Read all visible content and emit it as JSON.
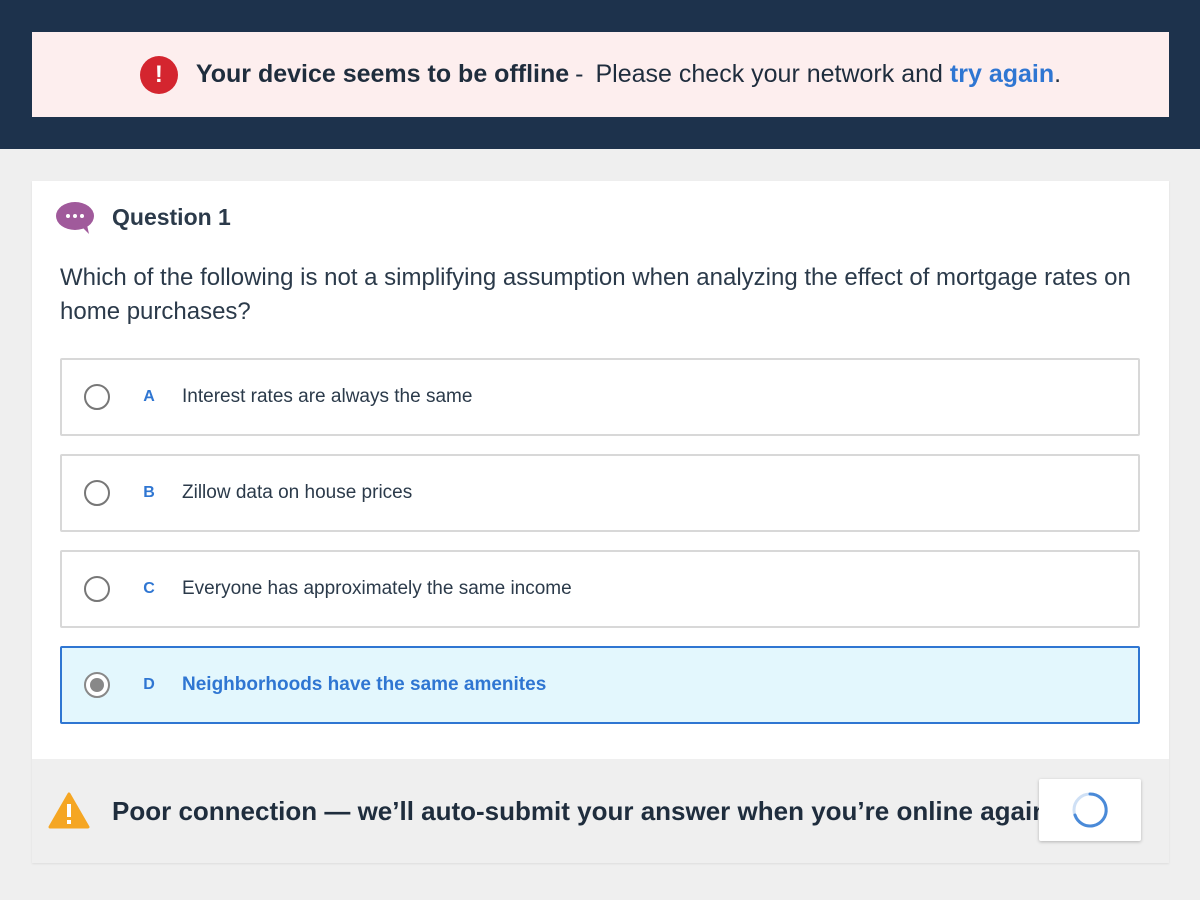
{
  "offline_banner": {
    "icon": "alert-circle-icon",
    "title": "Your device seems to be offline",
    "separator": "-",
    "message": "Please check your network and",
    "link": "try again",
    "period": ".",
    "color": "#d4252f"
  },
  "question": {
    "icon": "chat-bubble-icon",
    "title": "Question 1",
    "text": "Which of the following is not a simplifying assumption when analyzing the effect of mortgage rates on home purchases?",
    "options": [
      {
        "letter": "A",
        "text": "Interest rates are always the same",
        "selected": false
      },
      {
        "letter": "B",
        "text": "Zillow data on house prices",
        "selected": false
      },
      {
        "letter": "C",
        "text": "Everyone has approximately the same income",
        "selected": false
      },
      {
        "letter": "D",
        "text": "Neighborhoods have the same amenites",
        "selected": true
      }
    ]
  },
  "connection_notice": {
    "icon": "warning-triangle-icon",
    "text": "Poor connection — we’ll auto-submit your answer when you’re online again",
    "spinner": "loading-spinner-icon"
  },
  "colors": {
    "header_bg": "#1d324c",
    "accent": "#2f76d2",
    "warning": "#f5a623",
    "bubble": "#a05a9b"
  }
}
